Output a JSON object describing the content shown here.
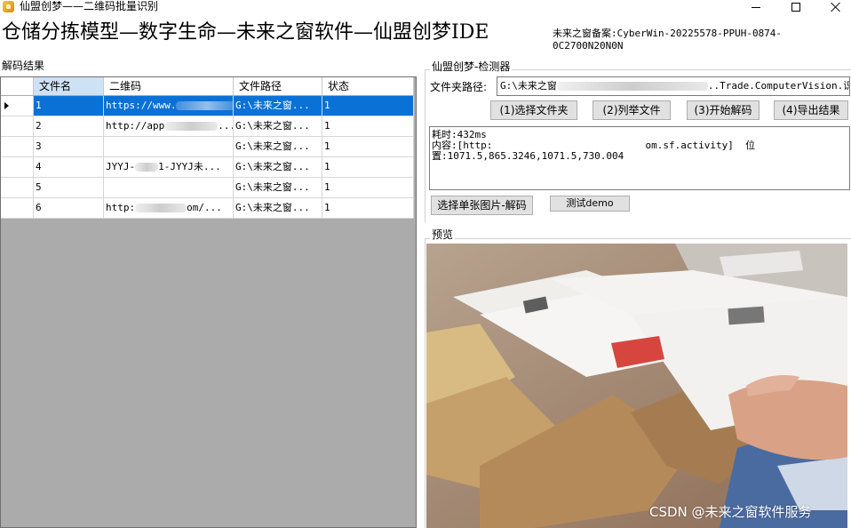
{
  "window": {
    "title": "仙盟创梦——二维码批量识别"
  },
  "header": {
    "heading": "仓储分拣模型—数字生命—未来之窗软件—仙盟创梦IDE",
    "filing": "未来之窗备案:CyberWin-20225578-PPUH-0874-0C2700N20N0N"
  },
  "left": {
    "section_label": "解码结果",
    "columns": [
      "文件名",
      "二维码",
      "文件路径",
      "状态"
    ],
    "rows": [
      {
        "name": "1",
        "code": "https://www.",
        "path": "G:\\未来之窗...",
        "status": "1"
      },
      {
        "name": "2",
        "code": "http://app",
        "path": "G:\\未来之窗...",
        "status": "1"
      },
      {
        "name": "3",
        "code": "",
        "path": "G:\\未来之窗...",
        "status": "1"
      },
      {
        "name": "4",
        "code": "JYYJ-",
        "code_tail": "1-JYYJ未...",
        "path": "G:\\未来之窗...",
        "status": "1"
      },
      {
        "name": "5",
        "code": "",
        "path": "G:\\未来之窗...",
        "status": "1"
      },
      {
        "name": "6",
        "code": "http:",
        "code_tail": "om/...",
        "path": "G:\\未来之窗...",
        "status": "1"
      }
    ],
    "code_tails": {
      "row2": "...",
      "row1": ""
    }
  },
  "detector": {
    "group_label": "仙盟创梦-检测器",
    "folder_label": "文件夹路径:",
    "folder_value": "G:\\未来之窗",
    "folder_value_tail": "..Trade.ComputerVision.识",
    "buttons": {
      "select_folder": "(1)选择文件夹",
      "list_files": "(2)列举文件",
      "start_decode": "(3)开始解码",
      "export_results": "(4)导出结果",
      "single_image": "选择单张图片-解码",
      "test_demo": "测试demo"
    },
    "result_text": "耗时:432ms\n内容:[http:                          om.sf.activity]  位\n置:1071.5,865.3246,1071.5,730.004"
  },
  "preview": {
    "label": "预览"
  },
  "watermark": "CSDN @未来之窗软件服务"
}
